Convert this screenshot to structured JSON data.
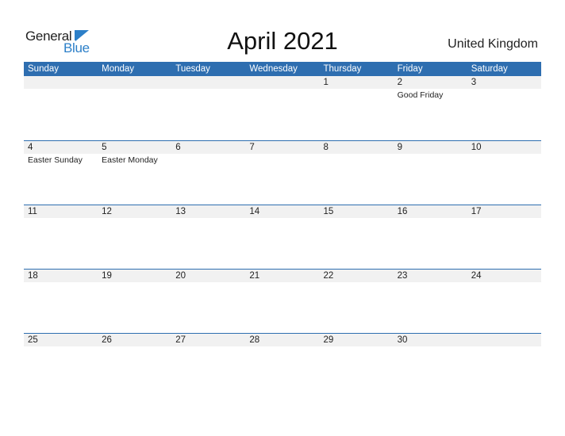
{
  "logo": {
    "line1": "General",
    "line2": "Blue",
    "accent": "#2c7fc8"
  },
  "header": {
    "title": "April 2021",
    "country": "United Kingdom"
  },
  "days": [
    "Sunday",
    "Monday",
    "Tuesday",
    "Wednesday",
    "Thursday",
    "Friday",
    "Saturday"
  ],
  "weeks": [
    {
      "dates": [
        "",
        "",
        "",
        "",
        "1",
        "2",
        "3"
      ],
      "holidays": [
        "",
        "",
        "",
        "",
        "",
        "Good Friday",
        ""
      ]
    },
    {
      "dates": [
        "4",
        "5",
        "6",
        "7",
        "8",
        "9",
        "10"
      ],
      "holidays": [
        "Easter Sunday",
        "Easter Monday",
        "",
        "",
        "",
        "",
        ""
      ]
    },
    {
      "dates": [
        "11",
        "12",
        "13",
        "14",
        "15",
        "16",
        "17"
      ],
      "holidays": [
        "",
        "",
        "",
        "",
        "",
        "",
        ""
      ]
    },
    {
      "dates": [
        "18",
        "19",
        "20",
        "21",
        "22",
        "23",
        "24"
      ],
      "holidays": [
        "",
        "",
        "",
        "",
        "",
        "",
        ""
      ]
    },
    {
      "dates": [
        "25",
        "26",
        "27",
        "28",
        "29",
        "30",
        ""
      ],
      "holidays": [
        "",
        "",
        "",
        "",
        "",
        "",
        ""
      ]
    }
  ],
  "colors": {
    "header_bg": "#2e6eb0",
    "date_strip_bg": "#f1f1f1"
  }
}
